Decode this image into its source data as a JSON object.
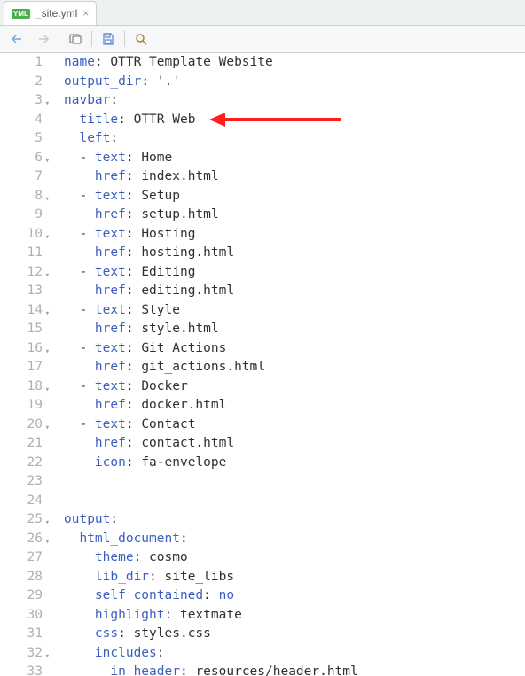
{
  "tab": {
    "badge": "YML",
    "filename": "_site.yml"
  },
  "lines": [
    {
      "n": 1,
      "fold": false,
      "segs": [
        [
          "k-key",
          "name"
        ],
        [
          "k-punct",
          ": "
        ],
        [
          "k-val",
          "OTTR Template Website"
        ]
      ]
    },
    {
      "n": 2,
      "fold": false,
      "segs": [
        [
          "k-key",
          "output_dir"
        ],
        [
          "k-punct",
          ": "
        ],
        [
          "k-val",
          "'.'"
        ]
      ]
    },
    {
      "n": 3,
      "fold": true,
      "segs": [
        [
          "k-key",
          "navbar"
        ],
        [
          "k-punct",
          ":"
        ]
      ]
    },
    {
      "n": 4,
      "fold": false,
      "arrow": true,
      "segs": [
        [
          "k-punct",
          "  "
        ],
        [
          "k-key",
          "title"
        ],
        [
          "k-punct",
          ": "
        ],
        [
          "k-val",
          "OTTR Web"
        ]
      ]
    },
    {
      "n": 5,
      "fold": false,
      "segs": [
        [
          "k-punct",
          "  "
        ],
        [
          "k-key",
          "left"
        ],
        [
          "k-punct",
          ":"
        ]
      ]
    },
    {
      "n": 6,
      "fold": true,
      "segs": [
        [
          "k-punct",
          "  - "
        ],
        [
          "k-key",
          "text"
        ],
        [
          "k-punct",
          ": "
        ],
        [
          "k-val",
          "Home"
        ]
      ]
    },
    {
      "n": 7,
      "fold": false,
      "segs": [
        [
          "k-punct",
          "    "
        ],
        [
          "k-key",
          "href"
        ],
        [
          "k-punct",
          ": "
        ],
        [
          "k-val",
          "index.html"
        ]
      ]
    },
    {
      "n": 8,
      "fold": true,
      "segs": [
        [
          "k-punct",
          "  - "
        ],
        [
          "k-key",
          "text"
        ],
        [
          "k-punct",
          ": "
        ],
        [
          "k-val",
          "Setup"
        ]
      ]
    },
    {
      "n": 9,
      "fold": false,
      "segs": [
        [
          "k-punct",
          "    "
        ],
        [
          "k-key",
          "href"
        ],
        [
          "k-punct",
          ": "
        ],
        [
          "k-val",
          "setup.html"
        ]
      ]
    },
    {
      "n": 10,
      "fold": true,
      "segs": [
        [
          "k-punct",
          "  - "
        ],
        [
          "k-key",
          "text"
        ],
        [
          "k-punct",
          ": "
        ],
        [
          "k-val",
          "Hosting"
        ]
      ]
    },
    {
      "n": 11,
      "fold": false,
      "segs": [
        [
          "k-punct",
          "    "
        ],
        [
          "k-key",
          "href"
        ],
        [
          "k-punct",
          ": "
        ],
        [
          "k-val",
          "hosting.html"
        ]
      ]
    },
    {
      "n": 12,
      "fold": true,
      "segs": [
        [
          "k-punct",
          "  - "
        ],
        [
          "k-key",
          "text"
        ],
        [
          "k-punct",
          ": "
        ],
        [
          "k-val",
          "Editing"
        ]
      ]
    },
    {
      "n": 13,
      "fold": false,
      "segs": [
        [
          "k-punct",
          "    "
        ],
        [
          "k-key",
          "href"
        ],
        [
          "k-punct",
          ": "
        ],
        [
          "k-val",
          "editing.html"
        ]
      ]
    },
    {
      "n": 14,
      "fold": true,
      "segs": [
        [
          "k-punct",
          "  - "
        ],
        [
          "k-key",
          "text"
        ],
        [
          "k-punct",
          ": "
        ],
        [
          "k-val",
          "Style"
        ]
      ]
    },
    {
      "n": 15,
      "fold": false,
      "segs": [
        [
          "k-punct",
          "    "
        ],
        [
          "k-key",
          "href"
        ],
        [
          "k-punct",
          ": "
        ],
        [
          "k-val",
          "style.html"
        ]
      ]
    },
    {
      "n": 16,
      "fold": true,
      "segs": [
        [
          "k-punct",
          "  - "
        ],
        [
          "k-key",
          "text"
        ],
        [
          "k-punct",
          ": "
        ],
        [
          "k-val",
          "Git Actions"
        ]
      ]
    },
    {
      "n": 17,
      "fold": false,
      "segs": [
        [
          "k-punct",
          "    "
        ],
        [
          "k-key",
          "href"
        ],
        [
          "k-punct",
          ": "
        ],
        [
          "k-val",
          "git_actions.html"
        ]
      ]
    },
    {
      "n": 18,
      "fold": true,
      "segs": [
        [
          "k-punct",
          "  - "
        ],
        [
          "k-key",
          "text"
        ],
        [
          "k-punct",
          ": "
        ],
        [
          "k-val",
          "Docker"
        ]
      ]
    },
    {
      "n": 19,
      "fold": false,
      "segs": [
        [
          "k-punct",
          "    "
        ],
        [
          "k-key",
          "href"
        ],
        [
          "k-punct",
          ": "
        ],
        [
          "k-val",
          "docker.html"
        ]
      ]
    },
    {
      "n": 20,
      "fold": true,
      "segs": [
        [
          "k-punct",
          "  - "
        ],
        [
          "k-key",
          "text"
        ],
        [
          "k-punct",
          ": "
        ],
        [
          "k-val",
          "Contact"
        ]
      ]
    },
    {
      "n": 21,
      "fold": false,
      "segs": [
        [
          "k-punct",
          "    "
        ],
        [
          "k-key",
          "href"
        ],
        [
          "k-punct",
          ": "
        ],
        [
          "k-val",
          "contact.html"
        ]
      ]
    },
    {
      "n": 22,
      "fold": false,
      "segs": [
        [
          "k-punct",
          "    "
        ],
        [
          "k-key",
          "icon"
        ],
        [
          "k-punct",
          ": "
        ],
        [
          "k-val",
          "fa-envelope"
        ]
      ]
    },
    {
      "n": 23,
      "fold": false,
      "segs": [
        [
          "k-punct",
          ""
        ]
      ]
    },
    {
      "n": 24,
      "fold": false,
      "segs": [
        [
          "k-punct",
          ""
        ]
      ]
    },
    {
      "n": 25,
      "fold": true,
      "segs": [
        [
          "k-key",
          "output"
        ],
        [
          "k-punct",
          ":"
        ]
      ]
    },
    {
      "n": 26,
      "fold": true,
      "segs": [
        [
          "k-punct",
          "  "
        ],
        [
          "k-key",
          "html_document"
        ],
        [
          "k-punct",
          ":"
        ]
      ]
    },
    {
      "n": 27,
      "fold": false,
      "segs": [
        [
          "k-punct",
          "    "
        ],
        [
          "k-key",
          "theme"
        ],
        [
          "k-punct",
          ": "
        ],
        [
          "k-val",
          "cosmo"
        ]
      ]
    },
    {
      "n": 28,
      "fold": false,
      "segs": [
        [
          "k-punct",
          "    "
        ],
        [
          "k-key",
          "lib_dir"
        ],
        [
          "k-punct",
          ": "
        ],
        [
          "k-val",
          "site_libs"
        ]
      ]
    },
    {
      "n": 29,
      "fold": false,
      "segs": [
        [
          "k-punct",
          "    "
        ],
        [
          "k-key",
          "self_contained"
        ],
        [
          "k-punct",
          ": "
        ],
        [
          "k-key",
          "no"
        ]
      ]
    },
    {
      "n": 30,
      "fold": false,
      "segs": [
        [
          "k-punct",
          "    "
        ],
        [
          "k-key",
          "highlight"
        ],
        [
          "k-punct",
          ": "
        ],
        [
          "k-val",
          "textmate"
        ]
      ]
    },
    {
      "n": 31,
      "fold": false,
      "segs": [
        [
          "k-punct",
          "    "
        ],
        [
          "k-key",
          "css"
        ],
        [
          "k-punct",
          ": "
        ],
        [
          "k-val",
          "styles.css"
        ]
      ]
    },
    {
      "n": 32,
      "fold": true,
      "segs": [
        [
          "k-punct",
          "    "
        ],
        [
          "k-key",
          "includes"
        ],
        [
          "k-punct",
          ":"
        ]
      ]
    },
    {
      "n": 33,
      "fold": false,
      "segs": [
        [
          "k-punct",
          "      "
        ],
        [
          "k-key",
          "in_header"
        ],
        [
          "k-punct",
          ": "
        ],
        [
          "k-val",
          "resources/header.html"
        ]
      ]
    }
  ]
}
